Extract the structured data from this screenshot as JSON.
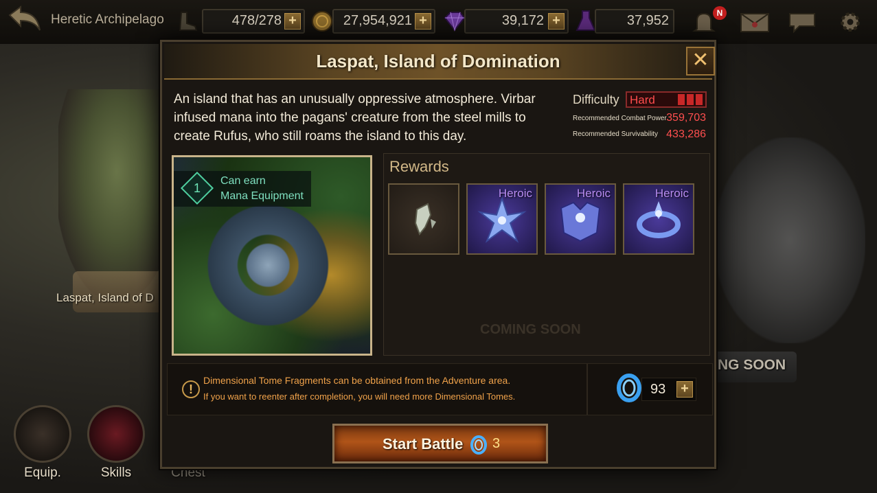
{
  "topbar": {
    "region": "Heretic Archipelago",
    "stamina": "478/278",
    "gold": "27,954,921",
    "gems": "39,172",
    "crystals": "37,952",
    "notification_badge": "N"
  },
  "map": {
    "left_island_label": "Laspat, Island of D",
    "right_coming_soon": "NG SOON",
    "mid_coming_soon": "COMING SOON"
  },
  "nav": {
    "equip": "Equip.",
    "skills": "Skills",
    "chest": "Chest"
  },
  "modal": {
    "title": "Laspat, Island of Domination",
    "close": "✕",
    "description": "An island that has an unusually oppressive atmosphere. Virbar infused mana into the pagans' creature from the steel mills to create Rufus, who still roams the island to this day.",
    "difficulty_label": "Difficulty",
    "difficulty_value": "Hard",
    "difficulty_level": 3,
    "rec_power_label": "Recommended Combat Power",
    "rec_power_value": "359,703",
    "rec_surv_label": "Recommended Survivability",
    "rec_surv_value": "433,286",
    "earn_number": "1",
    "earn_line1": "Can earn",
    "earn_line2": "Mana Equipment",
    "rewards_title": "Rewards",
    "rewards": [
      {
        "grade": "",
        "icon": "fragment-icon"
      },
      {
        "grade": "Heroic",
        "icon": "crystal-star-icon"
      },
      {
        "grade": "Heroic",
        "icon": "crystal-armor-icon"
      },
      {
        "grade": "Heroic",
        "icon": "crystal-ring-icon"
      }
    ],
    "info_line1": "Dimensional Tome Fragments can be obtained from the Adventure area.",
    "info_line2": "If you want to reenter after completion, you will need more Dimensional Tomes.",
    "tome_count": "93",
    "start_label": "Start Battle",
    "start_cost": "3"
  },
  "colors": {
    "accent_gold": "#c9a25a",
    "hard_red": "#ff4d4d",
    "heroic_purple": "#b88cf2",
    "info_orange": "#f0a24a"
  }
}
